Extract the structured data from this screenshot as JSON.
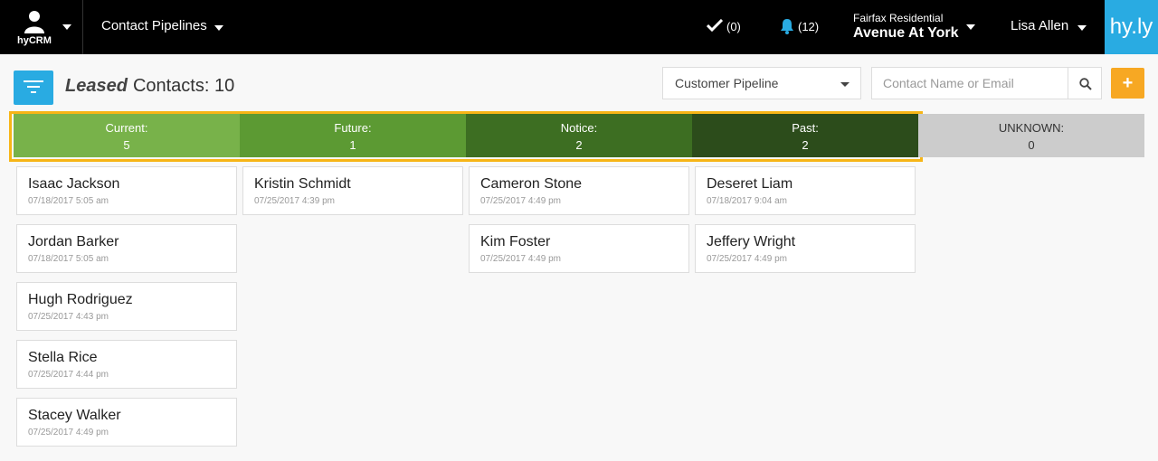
{
  "topbar": {
    "brand_label": "hyCRM",
    "nav_label": "Contact Pipelines",
    "todo_count": "(0)",
    "notification_count": "(12)",
    "property_company": "Fairfax Residential",
    "property_name": "Avenue At York",
    "user_name": "Lisa Allen",
    "logo_text": "hy.ly"
  },
  "toolbar": {
    "status": "Leased",
    "contacts_label": "Contacts:",
    "contacts_count": "10",
    "pipeline_selected": "Customer Pipeline",
    "search_placeholder": "Contact Name or Email",
    "add_label": "+"
  },
  "stages": [
    {
      "name": "Current:",
      "count": "5",
      "color": "#78b24a"
    },
    {
      "name": "Future:",
      "count": "1",
      "color": "#5c9a33"
    },
    {
      "name": "Notice:",
      "count": "2",
      "color": "#3d6e22"
    },
    {
      "name": "Past:",
      "count": "2",
      "color": "#2c4c1b"
    },
    {
      "name": "UNKNOWN:",
      "count": "0",
      "color": "#cccccc"
    }
  ],
  "columns": {
    "current": [
      {
        "name": "Isaac Jackson",
        "date": "07/18/2017 5:05 am"
      },
      {
        "name": "Jordan Barker",
        "date": "07/18/2017 5:05 am"
      },
      {
        "name": "Hugh Rodriguez",
        "date": "07/25/2017 4:43 pm"
      },
      {
        "name": "Stella Rice",
        "date": "07/25/2017 4:44 pm"
      },
      {
        "name": "Stacey Walker",
        "date": "07/25/2017 4:49 pm"
      }
    ],
    "future": [
      {
        "name": "Kristin Schmidt",
        "date": "07/25/2017 4:39 pm"
      }
    ],
    "notice": [
      {
        "name": "Cameron Stone",
        "date": "07/25/2017 4:49 pm"
      },
      {
        "name": "Kim Foster",
        "date": "07/25/2017 4:49 pm"
      }
    ],
    "past": [
      {
        "name": "Deseret Liam",
        "date": "07/18/2017 9:04 am"
      },
      {
        "name": "Jeffery Wright",
        "date": "07/25/2017 4:49 pm"
      }
    ]
  },
  "colors": {
    "accent_blue": "#29abe2",
    "accent_orange": "#f7a823",
    "highlight_border": "#f7b516"
  }
}
